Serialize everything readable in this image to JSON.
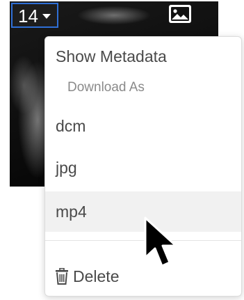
{
  "thumbnail": {
    "series_number": "14"
  },
  "menu": {
    "show_metadata": "Show Metadata",
    "download_as_header": "Download As",
    "download_options": [
      "dcm",
      "jpg",
      "mp4"
    ],
    "delete_label": "Delete",
    "hovered_item": "mp4"
  },
  "icons": {
    "series_dropdown": "chevron-down-icon",
    "thumbnail_action": "image-icon",
    "delete": "trash-icon",
    "pointer": "mouse-cursor"
  },
  "colors": {
    "selection_border": "#2f6fd6",
    "menu_text": "#4a4a4a",
    "header_text": "#8a8a8a",
    "hover_background": "#f1f1f1"
  }
}
